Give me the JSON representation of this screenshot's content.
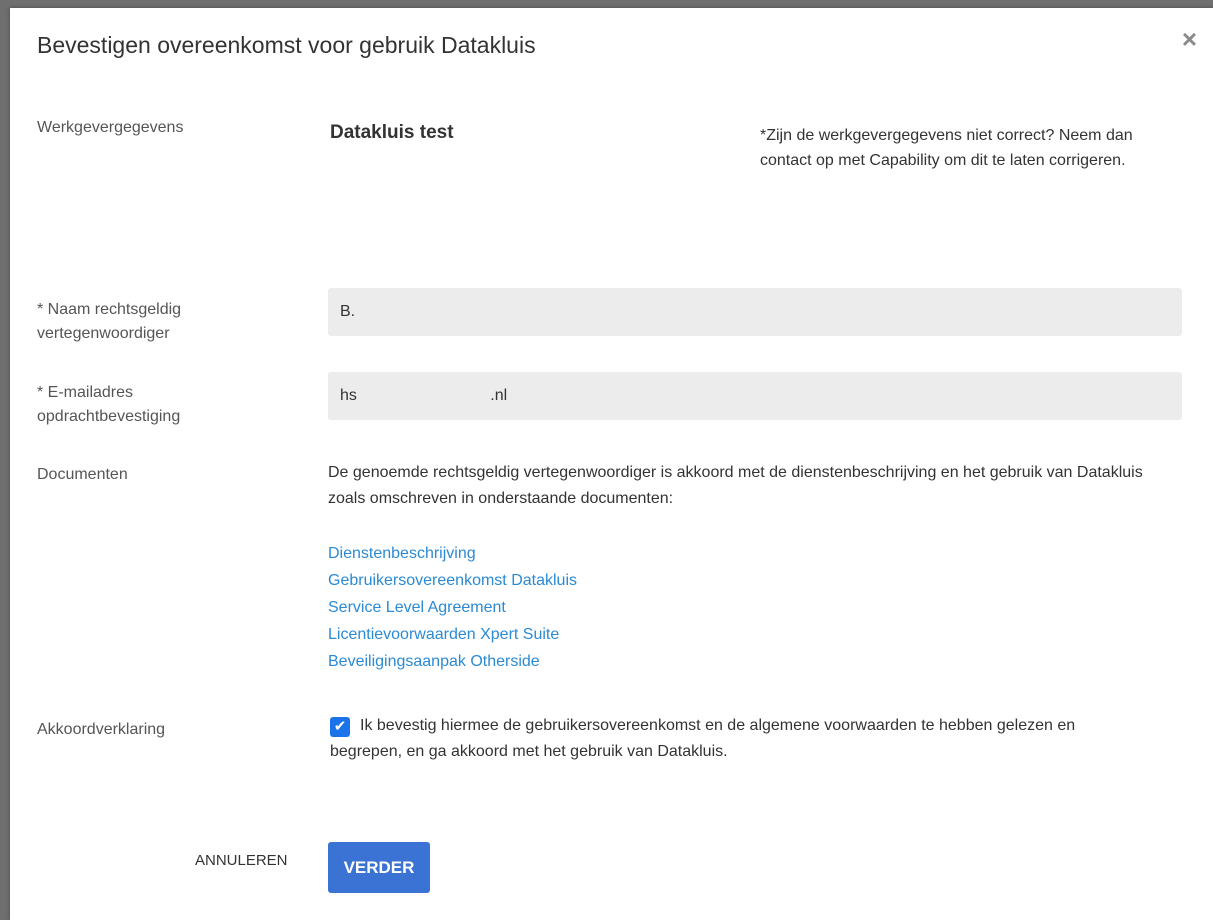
{
  "dialog": {
    "title": "Bevestigen overeenkomst voor gebruik Datakluis",
    "close_icon": "×"
  },
  "employer": {
    "label": "Werkgevergegevens",
    "name": "Datakluis test",
    "note": "*Zijn de werkgevergegevens niet correct? Neem dan contact op met Capability om dit te laten corrigeren."
  },
  "representative": {
    "label_line1": "* Naam rechtsgeldig",
    "label_line2": "vertegenwoordiger",
    "value": "B."
  },
  "email": {
    "label_line1": "* E-mailadres",
    "label_line2": "opdrachtbevestiging",
    "value": "hs                              .nl"
  },
  "documents": {
    "label": "Documenten",
    "text": "De genoemde rechtsgeldig vertegenwoordiger is akkoord met de dienstenbeschrijving en het gebruik van Datakluis zoals omschreven in onderstaande documenten:",
    "links": [
      "Dienstenbeschrijving",
      "Gebruikersovereenkomst Datakluis",
      "Service Level Agreement",
      "Licentievoorwaarden Xpert Suite",
      "Beveiligingsaanpak Otherside"
    ]
  },
  "agreement": {
    "label": "Akkoordverklaring",
    "checked": true,
    "check_icon": "✔",
    "text": "Ik bevestig hiermee de gebruikersovereenkomst en de algemene voorwaarden te hebben gelezen en begrepen, en ga akkoord met het gebruik van Datakluis."
  },
  "buttons": {
    "cancel": "ANNULEREN",
    "next": "VERDER"
  },
  "colors": {
    "link": "#2b8ad4",
    "primary": "#3b73d4",
    "checkbox": "#1a73e8"
  }
}
